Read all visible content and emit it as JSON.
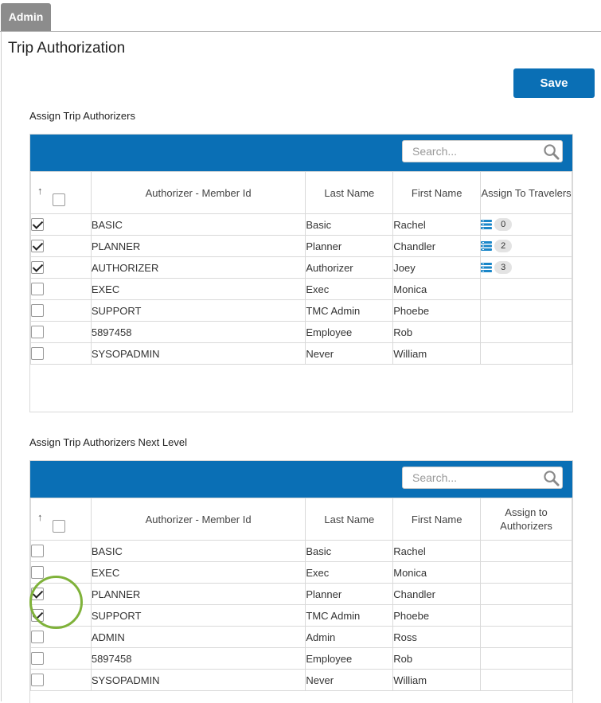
{
  "tab": {
    "label": "Admin"
  },
  "page": {
    "title": "Trip Authorization"
  },
  "actions": {
    "save_label": "Save"
  },
  "colors": {
    "accent": "#0a6fb5",
    "highlight": "#7fb23a",
    "tab_gray": "#8c8c8c"
  },
  "section1": {
    "title": "Assign Trip Authorizers",
    "search_placeholder": "Search...",
    "columns": [
      "Authorizer - Member Id",
      "Last Name",
      "First Name",
      "Assign To Travelers"
    ],
    "sort_icon": "↑",
    "rows": [
      {
        "checked": true,
        "id": "BASIC",
        "last": "Basic",
        "first": "Rachel",
        "assign_count": "0"
      },
      {
        "checked": true,
        "id": "PLANNER",
        "last": "Planner",
        "first": "Chandler",
        "assign_count": "2"
      },
      {
        "checked": true,
        "id": "AUTHORIZER",
        "last": "Authorizer",
        "first": "Joey",
        "assign_count": "3"
      },
      {
        "checked": false,
        "id": "EXEC",
        "last": "Exec",
        "first": "Monica",
        "assign_count": null
      },
      {
        "checked": false,
        "id": "SUPPORT",
        "last": "TMC Admin",
        "first": "Phoebe",
        "assign_count": null
      },
      {
        "checked": false,
        "id": "5897458",
        "last": "Employee",
        "first": "Rob",
        "assign_count": null
      },
      {
        "checked": false,
        "id": "SYSOPADMIN",
        "last": "Never",
        "first": "William",
        "assign_count": null
      }
    ]
  },
  "section2": {
    "title": "Assign Trip Authorizers Next Level",
    "search_placeholder": "Search...",
    "columns": [
      "Authorizer - Member Id",
      "Last Name",
      "First Name",
      "Assign to Authorizers"
    ],
    "sort_icon": "↑",
    "rows": [
      {
        "checked": false,
        "id": "BASIC",
        "last": "Basic",
        "first": "Rachel"
      },
      {
        "checked": false,
        "id": "EXEC",
        "last": "Exec",
        "first": "Monica"
      },
      {
        "checked": true,
        "id": "PLANNER",
        "last": "Planner",
        "first": "Chandler"
      },
      {
        "checked": true,
        "id": "SUPPORT",
        "last": "TMC Admin",
        "first": "Phoebe"
      },
      {
        "checked": false,
        "id": "ADMIN",
        "last": "Admin",
        "first": "Ross"
      },
      {
        "checked": false,
        "id": "5897458",
        "last": "Employee",
        "first": "Rob"
      },
      {
        "checked": false,
        "id": "SYSOPADMIN",
        "last": "Never",
        "first": "William"
      }
    ]
  }
}
